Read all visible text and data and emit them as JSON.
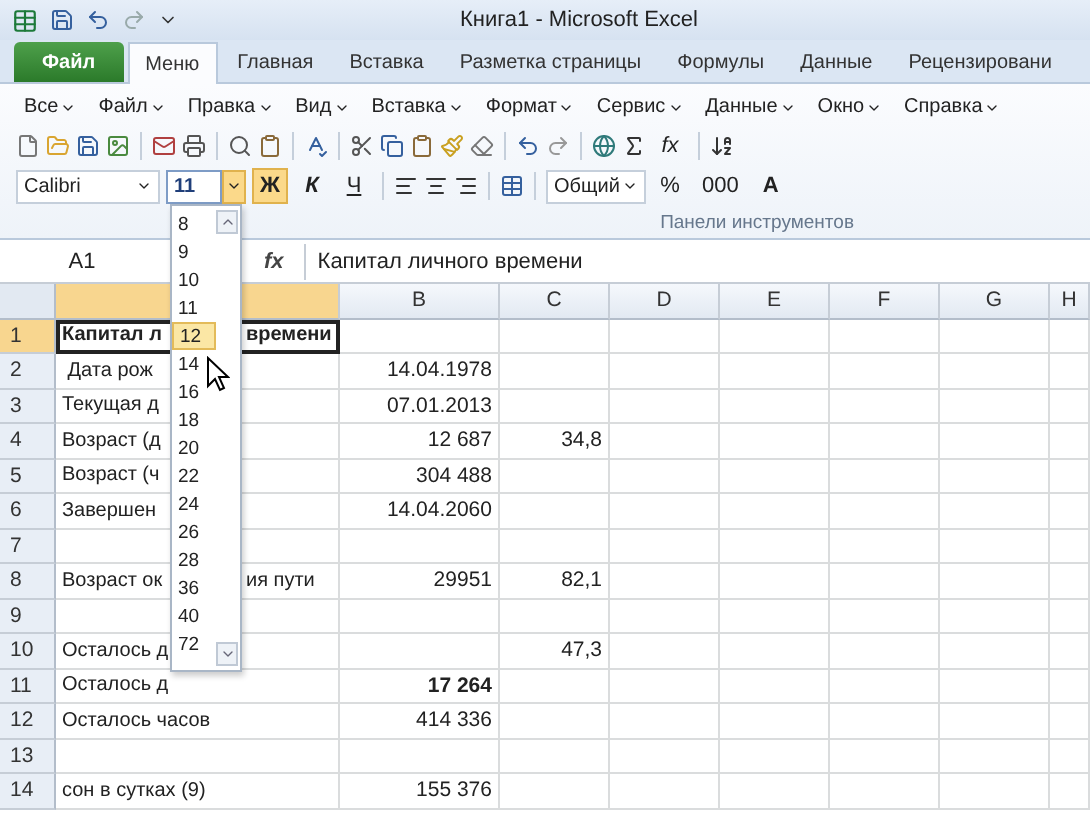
{
  "window": {
    "title": "Книга1 - Microsoft Excel"
  },
  "ribbon_tabs": [
    {
      "label": "Файл",
      "kind": "file",
      "selected": false
    },
    {
      "label": "Меню",
      "kind": "tab",
      "selected": true
    },
    {
      "label": "Главная",
      "kind": "tab",
      "selected": false
    },
    {
      "label": "Вставка",
      "kind": "tab",
      "selected": false
    },
    {
      "label": "Разметка страницы",
      "kind": "tab",
      "selected": false
    },
    {
      "label": "Формулы",
      "kind": "tab",
      "selected": false
    },
    {
      "label": "Данные",
      "kind": "tab",
      "selected": false
    },
    {
      "label": "Рецензировани",
      "kind": "tab",
      "selected": false
    }
  ],
  "menu": [
    "Все",
    "Файл",
    "Правка",
    "Вид",
    "Вставка",
    "Формат",
    "Сервис",
    "Данные",
    "Окно",
    "Справка"
  ],
  "toolbar": {
    "function_label": "fx",
    "font_name": "Calibri",
    "font_size": "11",
    "bold": "Ж",
    "italic": "К",
    "underline": "Ч",
    "number_format": "Общий",
    "percent": "%",
    "thousands": "000",
    "grow_font": "A",
    "group_label": "Панели инструментов"
  },
  "font_size_list": [
    {
      "label": "8",
      "selected": false
    },
    {
      "label": "9",
      "selected": false
    },
    {
      "label": "10",
      "selected": false
    },
    {
      "label": "11",
      "selected": false
    },
    {
      "label": "12",
      "selected": true
    },
    {
      "label": "14",
      "selected": false
    },
    {
      "label": "16",
      "selected": false
    },
    {
      "label": "18",
      "selected": false
    },
    {
      "label": "20",
      "selected": false
    },
    {
      "label": "22",
      "selected": false
    },
    {
      "label": "24",
      "selected": false
    },
    {
      "label": "26",
      "selected": false
    },
    {
      "label": "28",
      "selected": false
    },
    {
      "label": "36",
      "selected": false
    },
    {
      "label": "40",
      "selected": false
    },
    {
      "label": "72",
      "selected": false
    }
  ],
  "formula_bar": {
    "name_box": "A1",
    "fx": "fx",
    "formula": "Капитал личного времени"
  },
  "columns": [
    {
      "selected": true
    },
    {
      "label": "B",
      "selected": false
    },
    {
      "label": "C",
      "selected": false
    },
    {
      "label": "D",
      "selected": false
    },
    {
      "label": "E",
      "selected": false
    },
    {
      "label": "F",
      "selected": false
    },
    {
      "label": "G",
      "selected": false
    },
    {
      "label": "H",
      "selected": false
    }
  ],
  "rows": [
    {
      "header": "1",
      "selected": true,
      "a": {
        "left": "Капитал л",
        "right": "времени",
        "bold": true
      }
    },
    {
      "header": "2",
      "selected": false,
      "a": {
        "left": " Дата рож",
        "bold": false
      },
      "b": {
        "text": "14.04.1978",
        "bold": false
      }
    },
    {
      "header": "3",
      "selected": false,
      "a": {
        "left": "Текущая д",
        "bold": false
      },
      "b": {
        "text": "07.01.2013",
        "bold": false
      }
    },
    {
      "header": "4",
      "selected": false,
      "a": {
        "left": "Возраст (д",
        "bold": false
      },
      "b": {
        "text": "12 687",
        "bold": false
      },
      "c": {
        "text": "34,8",
        "bold": false
      }
    },
    {
      "header": "5",
      "selected": false,
      "a": {
        "left": "Возраст (ч",
        "bold": false
      },
      "b": {
        "text": "304 488",
        "bold": false
      }
    },
    {
      "header": "6",
      "selected": false,
      "a": {
        "left": "Завершен",
        "bold": false
      },
      "b": {
        "text": "14.04.2060",
        "bold": false
      }
    },
    {
      "header": "7",
      "selected": false
    },
    {
      "header": "8",
      "selected": false,
      "a": {
        "left": "Возраст ок",
        "right": "ия пути",
        "bold": false
      },
      "b": {
        "text": "29951",
        "bold": false
      },
      "c": {
        "text": "82,1",
        "bold": false
      }
    },
    {
      "header": "9",
      "selected": false
    },
    {
      "header": "10",
      "selected": false,
      "a": {
        "left": "Осталось д",
        "bold": false
      },
      "c": {
        "text": "47,3",
        "bold": false
      }
    },
    {
      "header": "11",
      "selected": false,
      "a": {
        "left": "Осталось д",
        "bold": false
      },
      "b": {
        "text": "17 264",
        "bold": true
      }
    },
    {
      "header": "12",
      "selected": false,
      "a": {
        "left": "Осталось часов",
        "bold": false
      },
      "b": {
        "text": "414 336",
        "bold": false
      }
    },
    {
      "header": "13",
      "selected": false
    },
    {
      "header": "14",
      "selected": false,
      "a": {
        "left": "сон в сутках (9)",
        "bold": false
      },
      "b": {
        "text": "155 376",
        "bold": false
      }
    }
  ]
}
